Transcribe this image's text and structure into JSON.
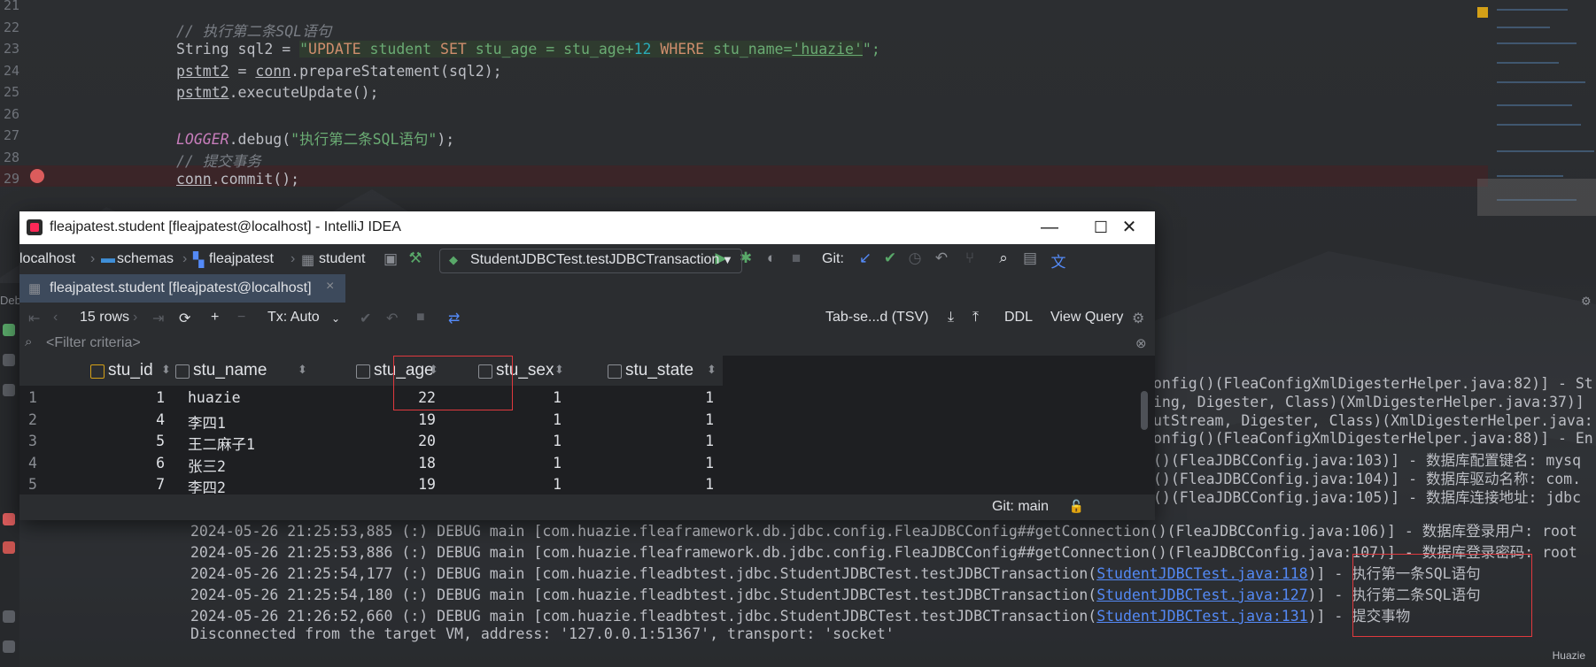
{
  "editor": {
    "lines": [
      {
        "num": "21",
        "code": ""
      },
      {
        "num": "22",
        "code": "// 执行第二条SQL语句"
      },
      {
        "num": "23",
        "code_parts": [
          "String sql2 = ",
          "\"",
          "UPDATE",
          " student ",
          "SET",
          " stu_age = stu_age+",
          "12",
          " ",
          "WHERE",
          " stu_name=",
          "'huazie'",
          "\";"
        ]
      },
      {
        "num": "24",
        "code": "pstmt2 = conn.prepareStatement(sql2);"
      },
      {
        "num": "25",
        "code": "pstmt2.executeUpdate();"
      },
      {
        "num": "26",
        "code": ""
      },
      {
        "num": "27",
        "code_parts": [
          "LOGGER",
          ".debug(",
          "\"执行第二条SQL语句\"",
          ");"
        ]
      },
      {
        "num": "28",
        "code": "// 提交事务"
      },
      {
        "num": "29",
        "code": "conn.commit();"
      }
    ]
  },
  "window": {
    "title": "fleajpatest.student [fleajpatest@localhost] - IntelliJ IDEA",
    "minimize": "—",
    "maximize": "☐",
    "close": "✕"
  },
  "breadcrumb": {
    "host": "localhost",
    "schemas": "schemas",
    "db": "fleajpatest",
    "table": "student"
  },
  "run_config": "StudentJDBCTest.testJDBCTransaction",
  "git_label": "Git:",
  "tab_label": "fleajpatest.student [fleajpatest@localhost]",
  "grid_toolbar": {
    "rows": "15 rows",
    "tx": "Tx: Auto",
    "format": "Tab-se...d (TSV)",
    "ddl": "DDL",
    "view_query": "View Query"
  },
  "filter_placeholder": "<Filter criteria>",
  "columns": [
    "stu_id",
    "stu_name",
    "stu_age",
    "stu_sex",
    "stu_state"
  ],
  "rows": [
    {
      "n": "1",
      "id": "1",
      "name": "huazie",
      "age": "22",
      "sex": "1",
      "state": "1"
    },
    {
      "n": "2",
      "id": "4",
      "name": "李四1",
      "age": "19",
      "sex": "1",
      "state": "1"
    },
    {
      "n": "3",
      "id": "5",
      "name": "王二麻子1",
      "age": "20",
      "sex": "1",
      "state": "1"
    },
    {
      "n": "4",
      "id": "6",
      "name": "张三2",
      "age": "18",
      "sex": "1",
      "state": "1"
    },
    {
      "n": "5",
      "id": "7",
      "name": "李四2",
      "age": "19",
      "sex": "1",
      "state": "1"
    }
  ],
  "status_git": "Git: main",
  "console": {
    "right_fragments": [
      "onfig()(FleaConfigXmlDigesterHelper.java:82)] - St",
      "ing, Digester, Class)(XmlDigesterHelper.java:37)]",
      "utStream, Digester, Class)(XmlDigesterHelper.java:",
      "onfig()(FleaConfigXmlDigesterHelper.java:88)] - En",
      "()(FleaJDBCConfig.java:103)] - 数据库配置键名: mysq",
      "()(FleaJDBCConfig.java:104)] - 数据库驱动名称: com.",
      "()(FleaJDBCConfig.java:105)] - 数据库连接地址: jdbc"
    ],
    "full_lines": [
      "2024-05-26 21:25:53,885 (:) DEBUG main [com.huazie.fleaframework.db.jdbc.config.FleaJDBCConfig##getConnection()(FleaJDBCConfig.java:106)] - 数据库登录用户: root",
      "2024-05-26 21:25:53,886 (:) DEBUG main [com.huazie.fleaframework.db.jdbc.config.FleaJDBCConfig##getConnection()(FleaJDBCConfig.java:107)] - 数据库登录密码: root"
    ],
    "debug_lines": [
      {
        "prefix": "2024-05-26 21:25:54,177 (:) DEBUG main [com.huazie.fleadbtest.jdbc.StudentJDBCTest.testJDBCTransaction(",
        "link": "StudentJDBCTest.java:118",
        "suffix": ")] - ",
        "msg": "执行第一条SQL语句"
      },
      {
        "prefix": "2024-05-26 21:25:54,180 (:) DEBUG main [com.huazie.fleadbtest.jdbc.StudentJDBCTest.testJDBCTransaction(",
        "link": "StudentJDBCTest.java:127",
        "suffix": ")] - ",
        "msg": "执行第二条SQL语句"
      },
      {
        "prefix": "2024-05-26 21:26:52,660 (:) DEBUG main [com.huazie.fleadbtest.jdbc.StudentJDBCTest.testJDBCTransaction(",
        "link": "StudentJDBCTest.java:131",
        "suffix": ")] - ",
        "msg": "提交事物"
      }
    ],
    "disconnect": "Disconnected from the target VM, address: '127.0.0.1:51367', transport: 'socket'",
    "watermark": "Huazie"
  },
  "colors": {
    "accent": "#3574f0",
    "highlight_box": "#e0393e",
    "link": "#548af7"
  }
}
